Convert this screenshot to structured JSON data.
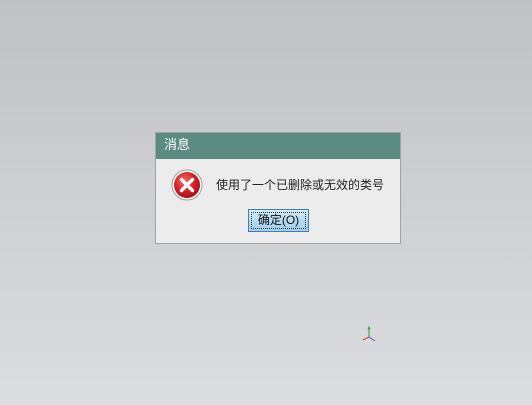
{
  "dialog": {
    "title": "消息",
    "message": "使用了一个已删除或无效的类号",
    "ok_label": "确定(O)",
    "icon": "error-icon"
  },
  "colors": {
    "titlebar": "#5c8b82",
    "dialog_bg": "#ececec",
    "button_bg": "#b4d9ef",
    "error_red": "#c0161a"
  },
  "viewport": {
    "triad_icon": "xyz-axis-icon"
  }
}
